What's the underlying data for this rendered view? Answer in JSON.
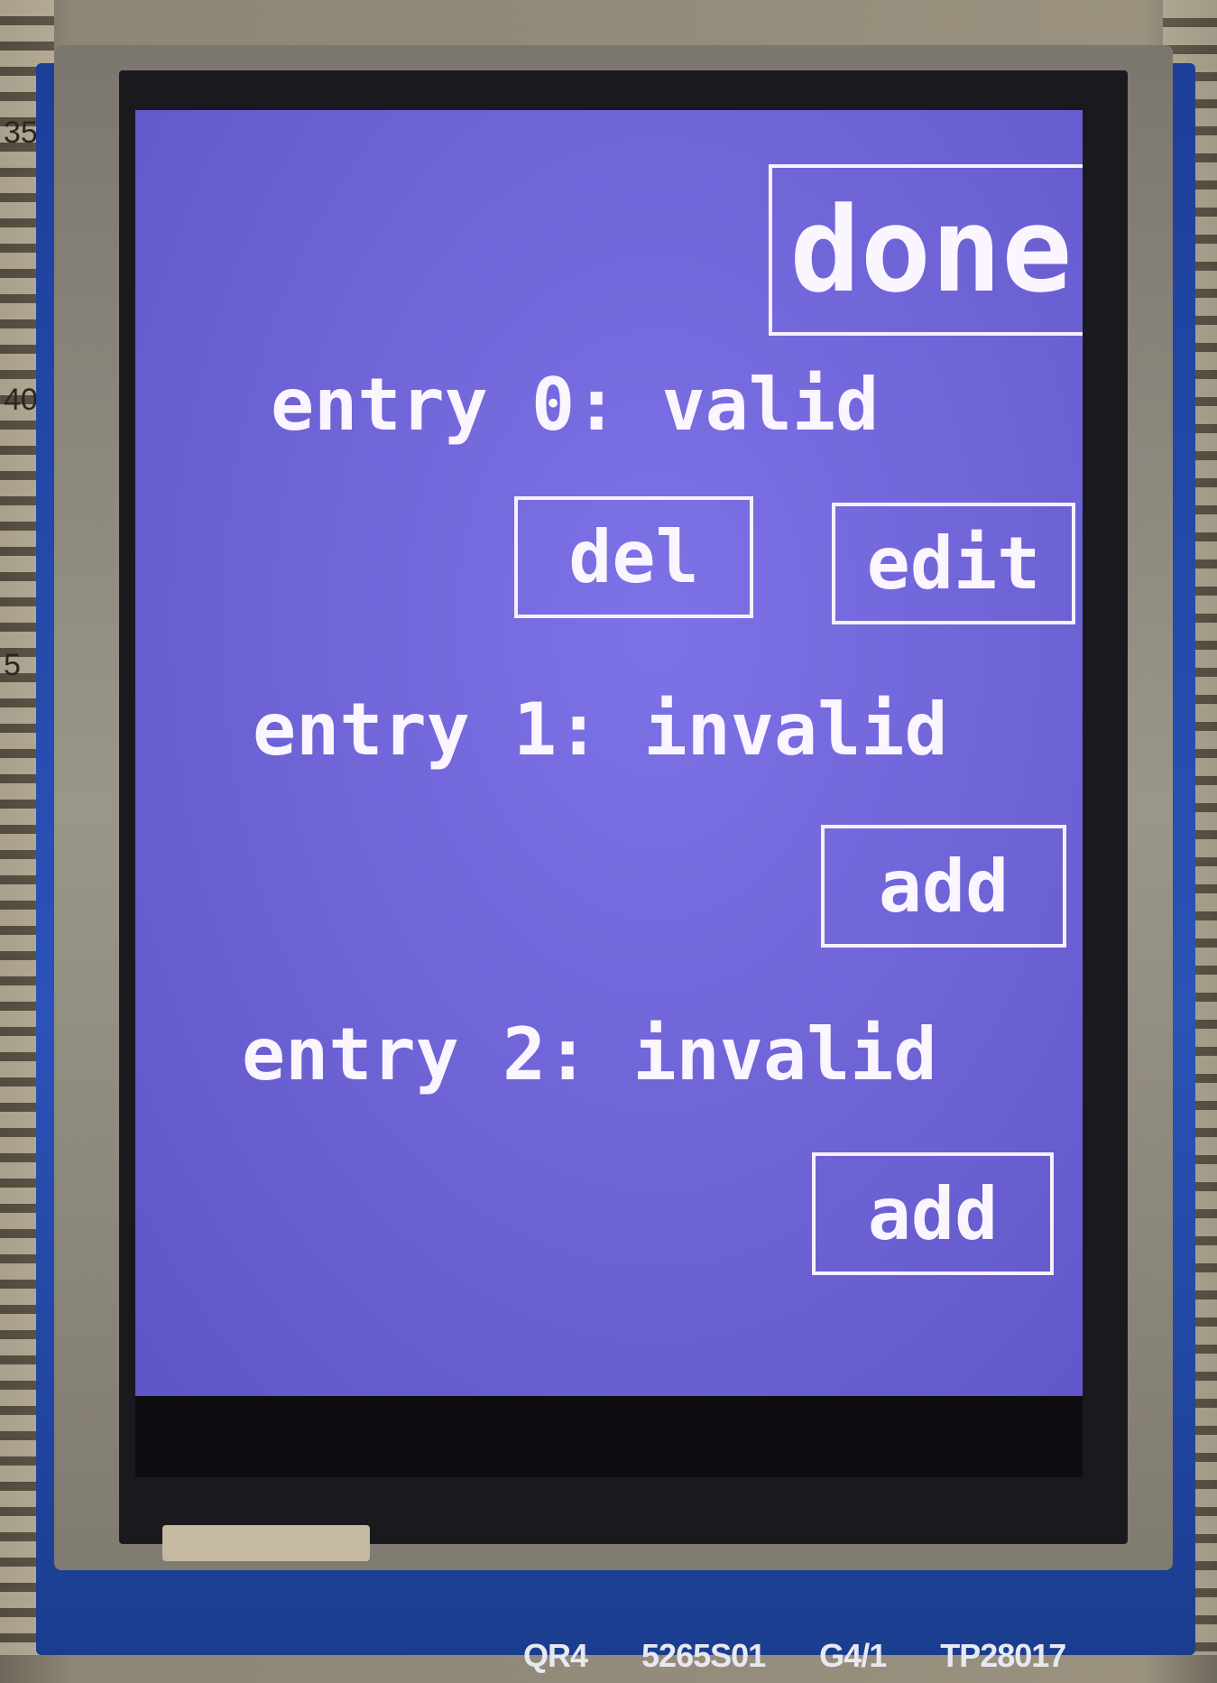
{
  "board": {
    "ruler_numbers": [
      "35",
      "40",
      "5"
    ],
    "silk_labels": [
      "QR4",
      "5265S01",
      "G4/1",
      "TP28017"
    ]
  },
  "screen": {
    "done_button": "done",
    "entries": [
      {
        "label": "entry 0: valid",
        "buttons": [
          "del",
          "edit"
        ]
      },
      {
        "label": "entry 1: invalid",
        "buttons": [
          "add"
        ]
      },
      {
        "label": "entry 2: invalid",
        "buttons": [
          "add"
        ]
      }
    ]
  },
  "colors": {
    "screen_bg": "#6e64d6",
    "text": "#fbf5ff",
    "pcb": "#2a53b8"
  }
}
